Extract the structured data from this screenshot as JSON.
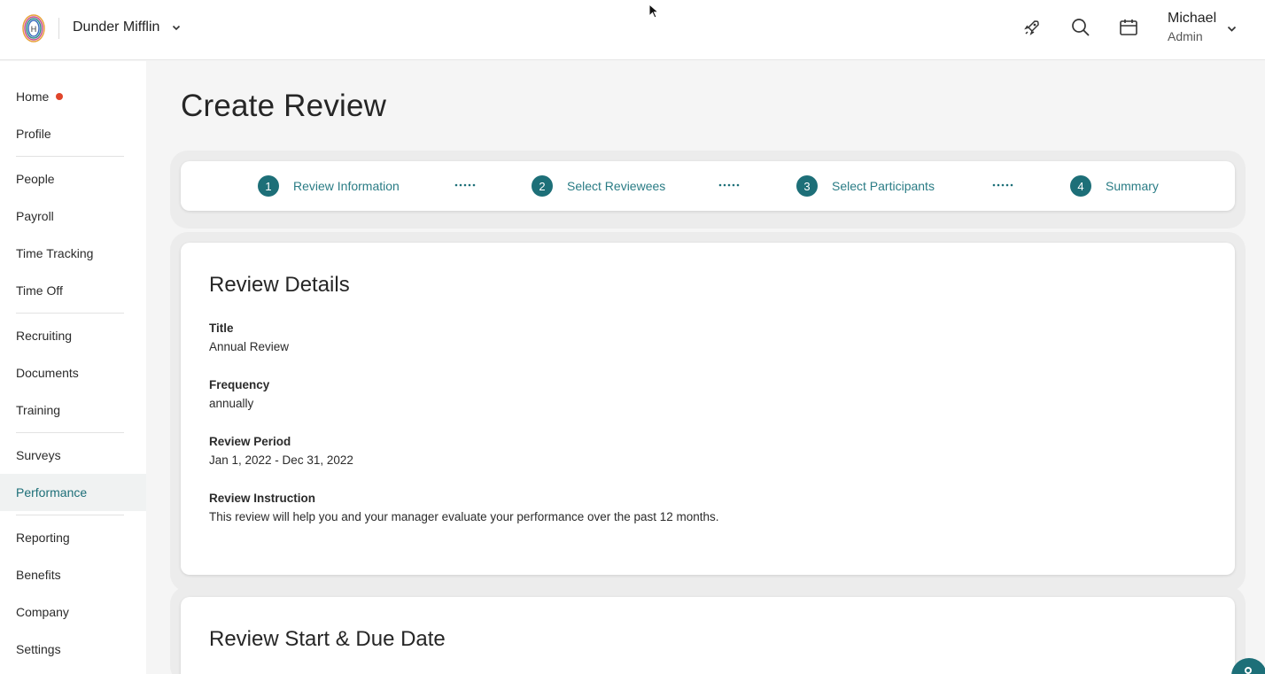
{
  "header": {
    "company_name": "Dunder Mifflin",
    "user_name": "Michael",
    "user_role": "Admin",
    "icons": [
      "logo-icon",
      "rocket-icon",
      "search-icon",
      "calendar-icon",
      "chevron-down-icon"
    ]
  },
  "sidebar": {
    "items": [
      {
        "label": "Home",
        "notification": true
      },
      {
        "label": "Profile"
      },
      {
        "label": "People"
      },
      {
        "label": "Payroll"
      },
      {
        "label": "Time Tracking"
      },
      {
        "label": "Time Off"
      },
      {
        "label": "Recruiting"
      },
      {
        "label": "Documents"
      },
      {
        "label": "Training"
      },
      {
        "label": "Surveys"
      },
      {
        "label": "Performance",
        "active": true
      },
      {
        "label": "Reporting"
      },
      {
        "label": "Benefits"
      },
      {
        "label": "Company"
      },
      {
        "label": "Settings"
      }
    ]
  },
  "page": {
    "title": "Create Review"
  },
  "stepper": {
    "steps": [
      {
        "number": "1",
        "label": "Review Information"
      },
      {
        "number": "2",
        "label": "Select Reviewees"
      },
      {
        "number": "3",
        "label": "Select Participants"
      },
      {
        "number": "4",
        "label": "Summary"
      }
    ]
  },
  "review_details": {
    "heading": "Review Details",
    "fields": [
      {
        "label": "Title",
        "value": "Annual Review"
      },
      {
        "label": "Frequency",
        "value": "annually"
      },
      {
        "label": "Review Period",
        "value": "Jan 1, 2022 - Dec 31, 2022"
      },
      {
        "label": "Review Instruction",
        "value": "This review will help you and your manager evaluate your performance over the past 12 months."
      }
    ]
  },
  "review_dates": {
    "heading": "Review Start & Due Date"
  },
  "colors": {
    "accent": "#1d6f78",
    "notification_dot": "#e0452b",
    "step_label": "#2a7c85"
  }
}
